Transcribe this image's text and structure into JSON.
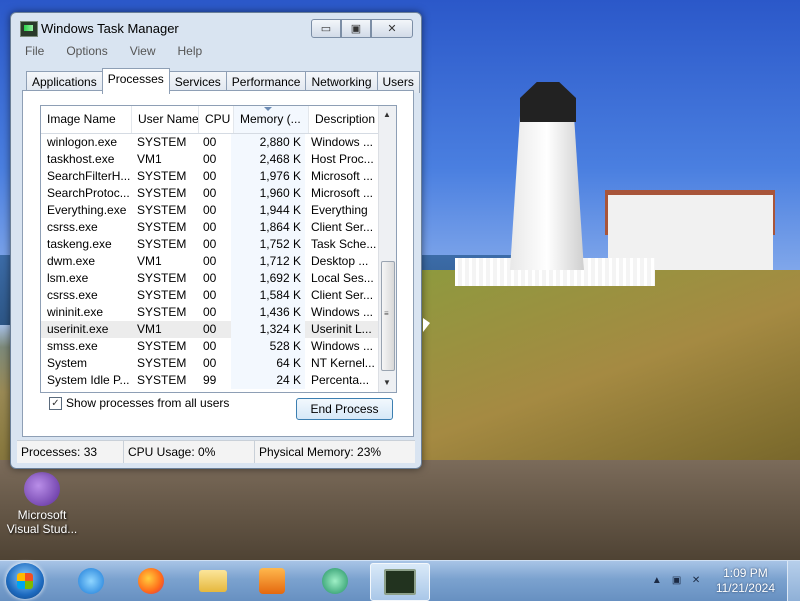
{
  "window": {
    "title": "Windows Task Manager",
    "minimize_glyph": "▭",
    "maximize_glyph": "▣",
    "close_glyph": "✕"
  },
  "menu": [
    "File",
    "Options",
    "View",
    "Help"
  ],
  "tabs": [
    "Applications",
    "Processes",
    "Services",
    "Performance",
    "Networking",
    "Users"
  ],
  "active_tab": "Processes",
  "columns": [
    "Image Name",
    "User Name",
    "CPU",
    "Memory (...",
    "Description"
  ],
  "rows": [
    {
      "image": "winlogon.exe",
      "user": "SYSTEM",
      "cpu": "00",
      "memory": "2,880 K",
      "desc": "Windows ..."
    },
    {
      "image": "taskhost.exe",
      "user": "VM1",
      "cpu": "00",
      "memory": "2,468 K",
      "desc": "Host Proc..."
    },
    {
      "image": "SearchFilterH...",
      "user": "SYSTEM",
      "cpu": "00",
      "memory": "1,976 K",
      "desc": "Microsoft ..."
    },
    {
      "image": "SearchProtoc...",
      "user": "SYSTEM",
      "cpu": "00",
      "memory": "1,960 K",
      "desc": "Microsoft ..."
    },
    {
      "image": "Everything.exe",
      "user": "SYSTEM",
      "cpu": "00",
      "memory": "1,944 K",
      "desc": "Everything"
    },
    {
      "image": "csrss.exe",
      "user": "SYSTEM",
      "cpu": "00",
      "memory": "1,864 K",
      "desc": "Client Ser..."
    },
    {
      "image": "taskeng.exe",
      "user": "SYSTEM",
      "cpu": "00",
      "memory": "1,752 K",
      "desc": "Task Sche..."
    },
    {
      "image": "dwm.exe",
      "user": "VM1",
      "cpu": "00",
      "memory": "1,712 K",
      "desc": "Desktop ..."
    },
    {
      "image": "lsm.exe",
      "user": "SYSTEM",
      "cpu": "00",
      "memory": "1,692 K",
      "desc": "Local Ses..."
    },
    {
      "image": "csrss.exe",
      "user": "SYSTEM",
      "cpu": "00",
      "memory": "1,584 K",
      "desc": "Client Ser..."
    },
    {
      "image": "wininit.exe",
      "user": "SYSTEM",
      "cpu": "00",
      "memory": "1,436 K",
      "desc": "Windows ..."
    },
    {
      "image": "userinit.exe",
      "user": "VM1",
      "cpu": "00",
      "memory": "1,324 K",
      "desc": "Userinit L..."
    },
    {
      "image": "smss.exe",
      "user": "SYSTEM",
      "cpu": "00",
      "memory": "528 K",
      "desc": "Windows ..."
    },
    {
      "image": "System",
      "user": "SYSTEM",
      "cpu": "00",
      "memory": "64 K",
      "desc": "NT Kernel..."
    },
    {
      "image": "System Idle P...",
      "user": "SYSTEM",
      "cpu": "99",
      "memory": "24 K",
      "desc": "Percenta..."
    }
  ],
  "selected_row_index": 11,
  "show_all_label": "Show processes from all users",
  "show_all_checked": true,
  "end_process_label": "End Process",
  "status": {
    "processes": "Processes: 33",
    "cpu": "CPU Usage: 0%",
    "memory": "Physical Memory: 23%"
  },
  "desktop_icon": {
    "line1": "Microsoft",
    "line2": "Visual Stud..."
  },
  "taskbar_apps": [
    "start-button",
    "internet-explorer",
    "firefox",
    "file-explorer",
    "media-player",
    "messenger",
    "task-manager"
  ],
  "clock": {
    "time": "1:09 PM",
    "date": "11/21/2024"
  }
}
